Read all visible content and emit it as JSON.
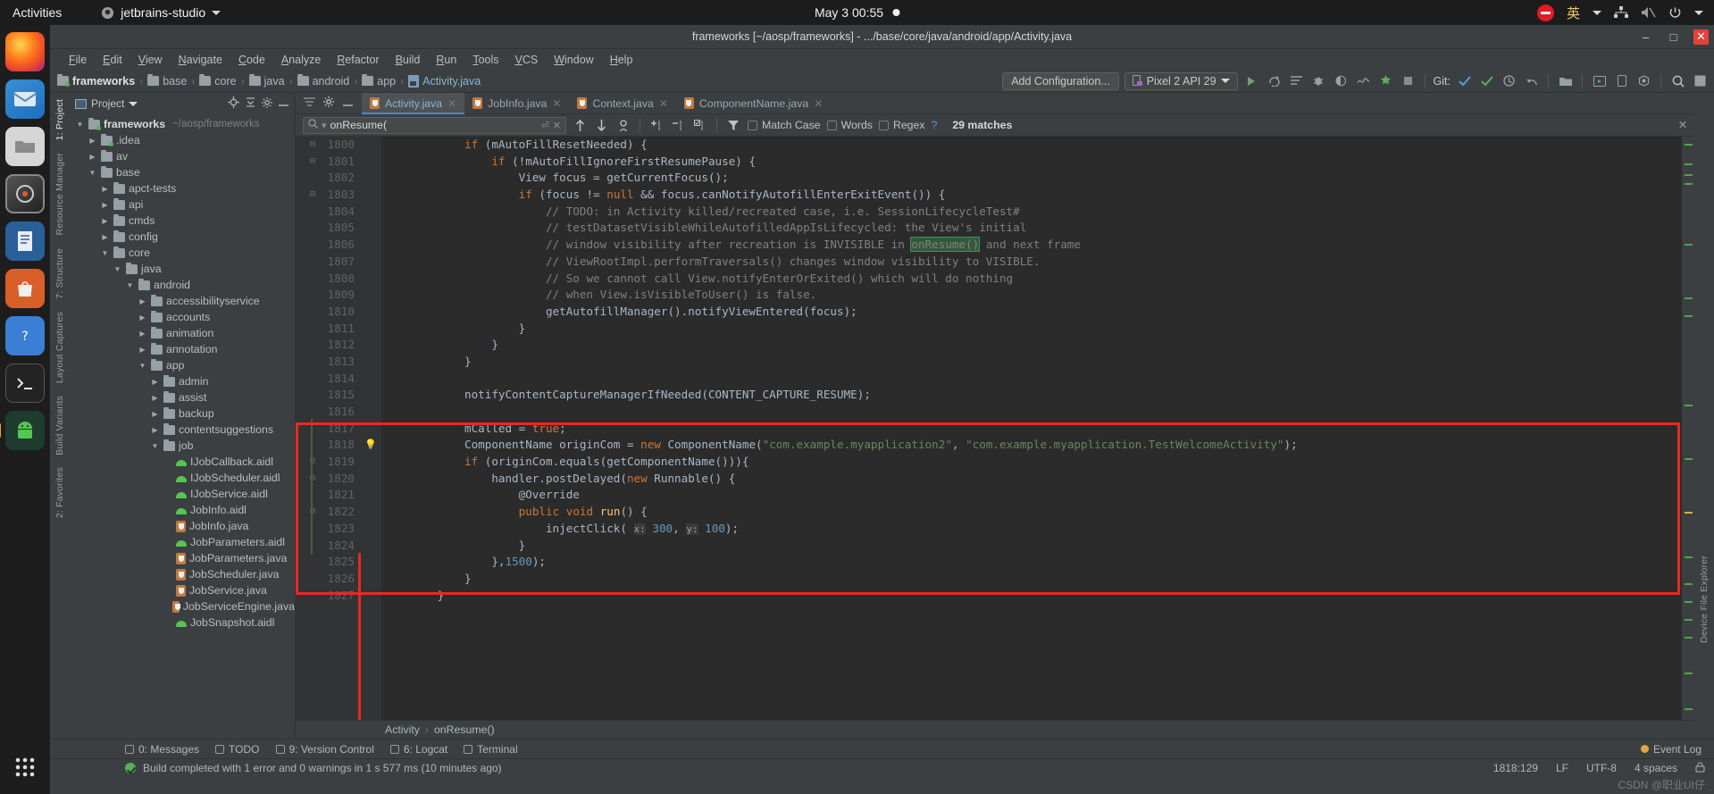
{
  "gnome": {
    "activities": "Activities",
    "app_name": "jetbrains-studio",
    "clock": "May 3  00:55",
    "input_method": "英",
    "icons": [
      "stop-recording-icon",
      "input-method-icon",
      "network-icon",
      "volume-muted-icon",
      "power-icon"
    ]
  },
  "dock": {
    "items": [
      {
        "name": "firefox",
        "label": "Firefox"
      },
      {
        "name": "thunderbird",
        "label": "Thunderbird"
      },
      {
        "name": "files",
        "label": "Files"
      },
      {
        "name": "rhythmbox",
        "label": "Rhythmbox"
      },
      {
        "name": "libreoffice-writer",
        "label": "LibreOffice Writer"
      },
      {
        "name": "ubuntu-software",
        "label": "Ubuntu Software"
      },
      {
        "name": "help",
        "label": "Help"
      },
      {
        "name": "terminal",
        "label": "Terminal"
      },
      {
        "name": "android-studio",
        "label": "Android Studio"
      }
    ],
    "show_apps": "Show Applications"
  },
  "window": {
    "title": "frameworks [~/aosp/frameworks] - .../base/core/java/android/app/Activity.java",
    "minimize": "–",
    "maximize": "□",
    "close": "✕"
  },
  "menubar": {
    "items": [
      "File",
      "Edit",
      "View",
      "Navigate",
      "Code",
      "Analyze",
      "Refactor",
      "Build",
      "Run",
      "Tools",
      "VCS",
      "Window",
      "Help"
    ]
  },
  "breadcrumb": {
    "items": [
      "frameworks",
      "base",
      "core",
      "java",
      "android",
      "app",
      "Activity.java"
    ]
  },
  "toolbar": {
    "add_configuration": "Add Configuration...",
    "device": "Pixel 2 API 29",
    "git_label": "Git:",
    "icons": [
      "run-icon",
      "rerun-icon",
      "list-icon",
      "debug-icon",
      "coverage-icon",
      "profiler-icon",
      "android-icon",
      "stop-icon",
      "update-project-icon",
      "commit-icon",
      "history-icon",
      "rollback-icon",
      "open-file-icon",
      "avd-manager-icon",
      "device-icon",
      "sdk-manager-icon",
      "search-everywhere-icon",
      "layout-inspector-icon"
    ]
  },
  "project_panel": {
    "title": "Project",
    "icons": [
      "locate-icon",
      "collapse-all-icon",
      "settings-icon",
      "hide-icon"
    ],
    "tree": [
      {
        "depth": 0,
        "arrow": "down",
        "icon": "folder-module",
        "label": "frameworks",
        "dim": "~/aosp/frameworks",
        "bold": true
      },
      {
        "depth": 1,
        "arrow": "right",
        "icon": "folder-module",
        "label": ".idea",
        "dim": "",
        "bold": false
      },
      {
        "depth": 1,
        "arrow": "right",
        "icon": "folder",
        "label": "av",
        "dim": "",
        "bold": false
      },
      {
        "depth": 1,
        "arrow": "down",
        "icon": "folder",
        "label": "base",
        "dim": "",
        "bold": false
      },
      {
        "depth": 2,
        "arrow": "right",
        "icon": "folder",
        "label": "apct-tests",
        "dim": "",
        "bold": false
      },
      {
        "depth": 2,
        "arrow": "right",
        "icon": "folder",
        "label": "api",
        "dim": "",
        "bold": false
      },
      {
        "depth": 2,
        "arrow": "right",
        "icon": "folder",
        "label": "cmds",
        "dim": "",
        "bold": false
      },
      {
        "depth": 2,
        "arrow": "right",
        "icon": "folder",
        "label": "config",
        "dim": "",
        "bold": false
      },
      {
        "depth": 2,
        "arrow": "down",
        "icon": "folder",
        "label": "core",
        "dim": "",
        "bold": false
      },
      {
        "depth": 3,
        "arrow": "down",
        "icon": "folder",
        "label": "java",
        "dim": "",
        "bold": false
      },
      {
        "depth": 4,
        "arrow": "down",
        "icon": "folder",
        "label": "android",
        "dim": "",
        "bold": false
      },
      {
        "depth": 5,
        "arrow": "right",
        "icon": "folder",
        "label": "accessibilityservice",
        "dim": "",
        "bold": false
      },
      {
        "depth": 5,
        "arrow": "right",
        "icon": "folder",
        "label": "accounts",
        "dim": "",
        "bold": false
      },
      {
        "depth": 5,
        "arrow": "right",
        "icon": "folder",
        "label": "animation",
        "dim": "",
        "bold": false
      },
      {
        "depth": 5,
        "arrow": "right",
        "icon": "folder",
        "label": "annotation",
        "dim": "",
        "bold": false
      },
      {
        "depth": 5,
        "arrow": "down",
        "icon": "folder",
        "label": "app",
        "dim": "",
        "bold": false
      },
      {
        "depth": 6,
        "arrow": "right",
        "icon": "folder",
        "label": "admin",
        "dim": "",
        "bold": false
      },
      {
        "depth": 6,
        "arrow": "right",
        "icon": "folder",
        "label": "assist",
        "dim": "",
        "bold": false
      },
      {
        "depth": 6,
        "arrow": "right",
        "icon": "folder",
        "label": "backup",
        "dim": "",
        "bold": false
      },
      {
        "depth": 6,
        "arrow": "right",
        "icon": "folder",
        "label": "contentsuggestions",
        "dim": "",
        "bold": false
      },
      {
        "depth": 6,
        "arrow": "down",
        "icon": "folder",
        "label": "job",
        "dim": "",
        "bold": false
      },
      {
        "depth": 7,
        "arrow": "none",
        "icon": "aidl",
        "label": "IJobCallback.aidl",
        "dim": "",
        "bold": false
      },
      {
        "depth": 7,
        "arrow": "none",
        "icon": "aidl",
        "label": "IJobScheduler.aidl",
        "dim": "",
        "bold": false
      },
      {
        "depth": 7,
        "arrow": "none",
        "icon": "aidl",
        "label": "IJobService.aidl",
        "dim": "",
        "bold": false
      },
      {
        "depth": 7,
        "arrow": "none",
        "icon": "aidl",
        "label": "JobInfo.aidl",
        "dim": "",
        "bold": false
      },
      {
        "depth": 7,
        "arrow": "none",
        "icon": "java",
        "label": "JobInfo.java",
        "dim": "",
        "bold": false
      },
      {
        "depth": 7,
        "arrow": "none",
        "icon": "aidl",
        "label": "JobParameters.aidl",
        "dim": "",
        "bold": false
      },
      {
        "depth": 7,
        "arrow": "none",
        "icon": "java",
        "label": "JobParameters.java",
        "dim": "",
        "bold": false
      },
      {
        "depth": 7,
        "arrow": "none",
        "icon": "java",
        "label": "JobScheduler.java",
        "dim": "",
        "bold": false
      },
      {
        "depth": 7,
        "arrow": "none",
        "icon": "java",
        "label": "JobService.java",
        "dim": "",
        "bold": false
      },
      {
        "depth": 7,
        "arrow": "none",
        "icon": "java",
        "label": "JobServiceEngine.java",
        "dim": "",
        "bold": false
      },
      {
        "depth": 7,
        "arrow": "none",
        "icon": "aidl",
        "label": "JobSnapshot.aidl",
        "dim": "",
        "bold": false
      }
    ]
  },
  "left_rail": [
    "1: Project",
    "Resource Manager",
    "7: Structure",
    "Layout Captures",
    "Build Variants",
    "2: Favorites"
  ],
  "right_rail": [
    "Device File Explorer"
  ],
  "tabs": [
    {
      "label": "Activity.java",
      "active": true
    },
    {
      "label": "JobInfo.java",
      "active": false
    },
    {
      "label": "Context.java",
      "active": false
    },
    {
      "label": "ComponentName.java",
      "active": false
    }
  ],
  "find": {
    "query": "onResume(",
    "placeholder": "Search",
    "match_case": "Match Case",
    "words": "Words",
    "regex": "Regex",
    "help": "?",
    "matches": "29 matches",
    "icons": [
      "find-prev-icon",
      "find-next-icon",
      "select-all-icon",
      "add-line-icon",
      "remove-line-icon",
      "select-occurrences-icon",
      "filter-icon",
      "close-icon"
    ]
  },
  "code": {
    "first_line_number": 1800,
    "lines": [
      {
        "n": 1800,
        "fold": "+",
        "tokens": [
          {
            "t": "            ",
            "c": ""
          },
          {
            "t": "if",
            "c": "kw"
          },
          {
            "t": " (mAutoFillResetNeeded) {",
            "c": ""
          }
        ]
      },
      {
        "n": 1801,
        "fold": "+",
        "tokens": [
          {
            "t": "                ",
            "c": ""
          },
          {
            "t": "if",
            "c": "kw"
          },
          {
            "t": " (!mAutoFillIgnoreFirstResumePause) {",
            "c": ""
          }
        ]
      },
      {
        "n": 1802,
        "fold": "",
        "tokens": [
          {
            "t": "                    View focus = getCurrentFocus();",
            "c": ""
          }
        ]
      },
      {
        "n": 1803,
        "fold": "+",
        "tokens": [
          {
            "t": "                    ",
            "c": ""
          },
          {
            "t": "if",
            "c": "kw"
          },
          {
            "t": " (focus != ",
            "c": ""
          },
          {
            "t": "null",
            "c": "kw"
          },
          {
            "t": " && focus.canNotifyAutofillEnterExitEvent()) {",
            "c": ""
          }
        ]
      },
      {
        "n": 1804,
        "fold": "",
        "tokens": [
          {
            "t": "                        // TODO: in Activity killed/recreated case, i.e. SessionLifecycleTest#",
            "c": "cmt"
          }
        ]
      },
      {
        "n": 1805,
        "fold": "",
        "tokens": [
          {
            "t": "                        // testDatasetVisibleWhileAutofilledAppIsLifecycled: the View's initial",
            "c": "cmt"
          }
        ]
      },
      {
        "n": 1806,
        "fold": "",
        "tokens": [
          {
            "t": "                        // window visibility after recreation is INVISIBLE in ",
            "c": "cmt"
          },
          {
            "t": "onResume()",
            "c": "cmt hl"
          },
          {
            "t": " and next frame",
            "c": "cmt"
          }
        ]
      },
      {
        "n": 1807,
        "fold": "",
        "tokens": [
          {
            "t": "                        // ViewRootImpl.performTraversals() changes window visibility to VISIBLE.",
            "c": "cmt"
          }
        ]
      },
      {
        "n": 1808,
        "fold": "",
        "tokens": [
          {
            "t": "                        // So we cannot call View.notifyEnterOrExited() which will do nothing",
            "c": "cmt"
          }
        ]
      },
      {
        "n": 1809,
        "fold": "",
        "tokens": [
          {
            "t": "                        // when View.isVisibleToUser() is false.",
            "c": "cmt"
          }
        ]
      },
      {
        "n": 1810,
        "fold": "",
        "tokens": [
          {
            "t": "                        getAutofillManager().notifyViewEntered(focus);",
            "c": ""
          }
        ]
      },
      {
        "n": 1811,
        "fold": "",
        "tokens": [
          {
            "t": "                    }",
            "c": ""
          }
        ]
      },
      {
        "n": 1812,
        "fold": "",
        "tokens": [
          {
            "t": "                }",
            "c": ""
          }
        ]
      },
      {
        "n": 1813,
        "fold": "",
        "tokens": [
          {
            "t": "            }",
            "c": ""
          }
        ]
      },
      {
        "n": 1814,
        "fold": "",
        "tokens": [
          {
            "t": "",
            "c": ""
          }
        ]
      },
      {
        "n": 1815,
        "fold": "",
        "tokens": [
          {
            "t": "            notifyContentCaptureManagerIfNeeded(CONTENT_CAPTURE_RESUME);",
            "c": ""
          }
        ]
      },
      {
        "n": 1816,
        "fold": "",
        "tokens": [
          {
            "t": "",
            "c": ""
          }
        ]
      },
      {
        "n": 1817,
        "fold": "",
        "tokens": [
          {
            "t": "            mCalled = ",
            "c": ""
          },
          {
            "t": "true",
            "c": "kw"
          },
          {
            "t": ";",
            "c": ""
          }
        ]
      },
      {
        "n": 1818,
        "fold": "",
        "tokens": [
          {
            "t": "            ComponentName originCom = ",
            "c": ""
          },
          {
            "t": "new",
            "c": "kw"
          },
          {
            "t": " ComponentName(",
            "c": ""
          },
          {
            "t": "\"com.example.myapplication2\"",
            "c": "str"
          },
          {
            "t": ", ",
            "c": ""
          },
          {
            "t": "\"com.example.myapplication.TestWelcomeActivity\"",
            "c": "str"
          },
          {
            "t": ");",
            "c": ""
          }
        ]
      },
      {
        "n": 1819,
        "fold": "+",
        "tokens": [
          {
            "t": "            ",
            "c": ""
          },
          {
            "t": "if",
            "c": "kw"
          },
          {
            "t": " (originCom.equals(getComponentName())){",
            "c": ""
          }
        ]
      },
      {
        "n": 1820,
        "fold": "+",
        "tokens": [
          {
            "t": "                handler.postDelayed(",
            "c": ""
          },
          {
            "t": "new",
            "c": "kw"
          },
          {
            "t": " Runnable() {",
            "c": ""
          }
        ]
      },
      {
        "n": 1821,
        "fold": "",
        "tokens": [
          {
            "t": "                    @Override",
            "c": ""
          }
        ]
      },
      {
        "n": 1822,
        "fold": "+",
        "tokens": [
          {
            "t": "                    ",
            "c": ""
          },
          {
            "t": "public",
            "c": "kw"
          },
          {
            "t": " ",
            "c": ""
          },
          {
            "t": "void",
            "c": "kw"
          },
          {
            "t": " ",
            "c": ""
          },
          {
            "t": "run",
            "c": "fn"
          },
          {
            "t": "() {",
            "c": ""
          }
        ]
      },
      {
        "n": 1823,
        "fold": "",
        "tokens": [
          {
            "t": "                        injectClick( ",
            "c": ""
          },
          {
            "t": "x:",
            "c": "hint"
          },
          {
            "t": " ",
            "c": ""
          },
          {
            "t": "300",
            "c": "num"
          },
          {
            "t": ", ",
            "c": ""
          },
          {
            "t": "y:",
            "c": "hint"
          },
          {
            "t": " ",
            "c": ""
          },
          {
            "t": "100",
            "c": "num"
          },
          {
            "t": ");",
            "c": ""
          }
        ]
      },
      {
        "n": 1824,
        "fold": "",
        "tokens": [
          {
            "t": "                    }",
            "c": ""
          }
        ]
      },
      {
        "n": 1825,
        "fold": "",
        "tokens": [
          {
            "t": "                },",
            "c": ""
          },
          {
            "t": "1500",
            "c": "num"
          },
          {
            "t": ");",
            "c": ""
          }
        ]
      },
      {
        "n": 1826,
        "fold": "",
        "tokens": [
          {
            "t": "            }",
            "c": ""
          }
        ]
      },
      {
        "n": 1827,
        "fold": "",
        "tokens": [
          {
            "t": "        }",
            "c": ""
          }
        ]
      }
    ],
    "bulb_line": 1818
  },
  "code_breadcrumb": {
    "items": [
      "Activity",
      "onResume()"
    ]
  },
  "bottom_tools": {
    "items": [
      "0: Messages",
      "TODO",
      "9: Version Control",
      "6: Logcat",
      "Terminal"
    ],
    "event_log": "Event Log"
  },
  "status": {
    "message": "Build completed with 1 error and 0 warnings in 1 s 577 ms (10 minutes ago)",
    "caret": "1818:129",
    "line_sep": "LF",
    "encoding": "UTF-8",
    "indent": "4 spaces",
    "watermark": "CSDN @职业UI仔"
  },
  "colors": {
    "accent": "#4a88c7",
    "editor_bg": "#2b2b2b",
    "panel_bg": "#3c3f41",
    "string": "#6a8759",
    "keyword": "#cc7832",
    "comment": "#808080",
    "number": "#6897bb",
    "annotation_box": "#e52b20"
  }
}
